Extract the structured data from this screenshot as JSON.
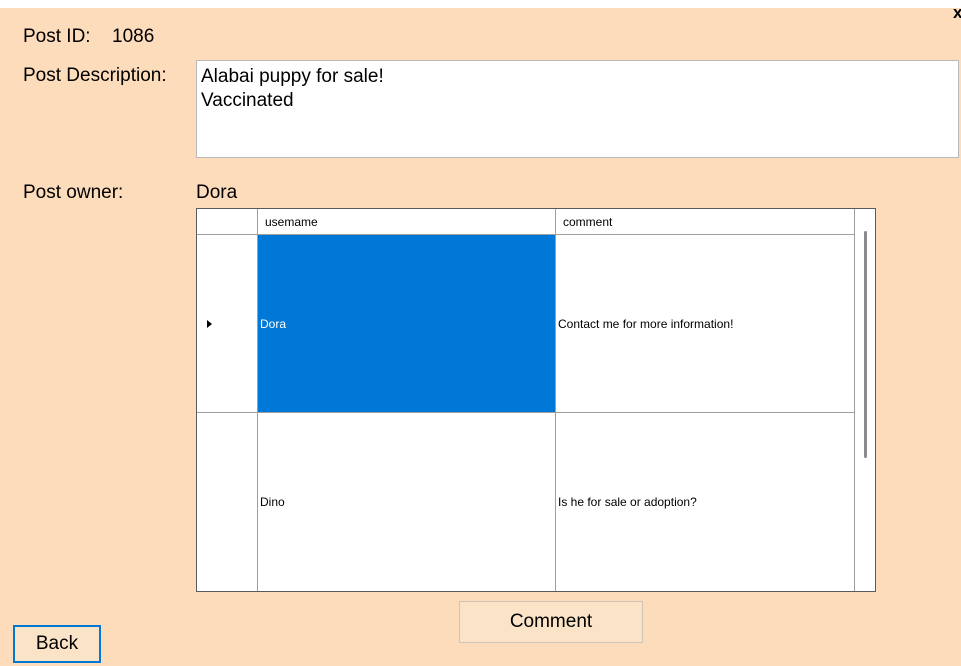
{
  "window": {
    "close_glyph": "x"
  },
  "post": {
    "id_label": "Post ID:",
    "id_value": "1086",
    "description_label": "Post Description:",
    "description_lines": [
      "Alabai puppy for sale!",
      "Vaccinated"
    ],
    "owner_label": "Post owner:",
    "owner_value": "Dora"
  },
  "comments_grid": {
    "columns": [
      "usemame",
      "comment"
    ],
    "rows": [
      {
        "username": "Dora",
        "comment": "Contact me for more information!",
        "selected": true,
        "current": true
      },
      {
        "username": "Dino",
        "comment": "Is he for sale or adoption?",
        "selected": false,
        "current": false
      }
    ]
  },
  "buttons": {
    "comment": "Comment",
    "back": "Back"
  },
  "colors": {
    "form_bg": "#fddcbc",
    "selection": "#0078d7",
    "button_bg": "#fbe3c7"
  }
}
